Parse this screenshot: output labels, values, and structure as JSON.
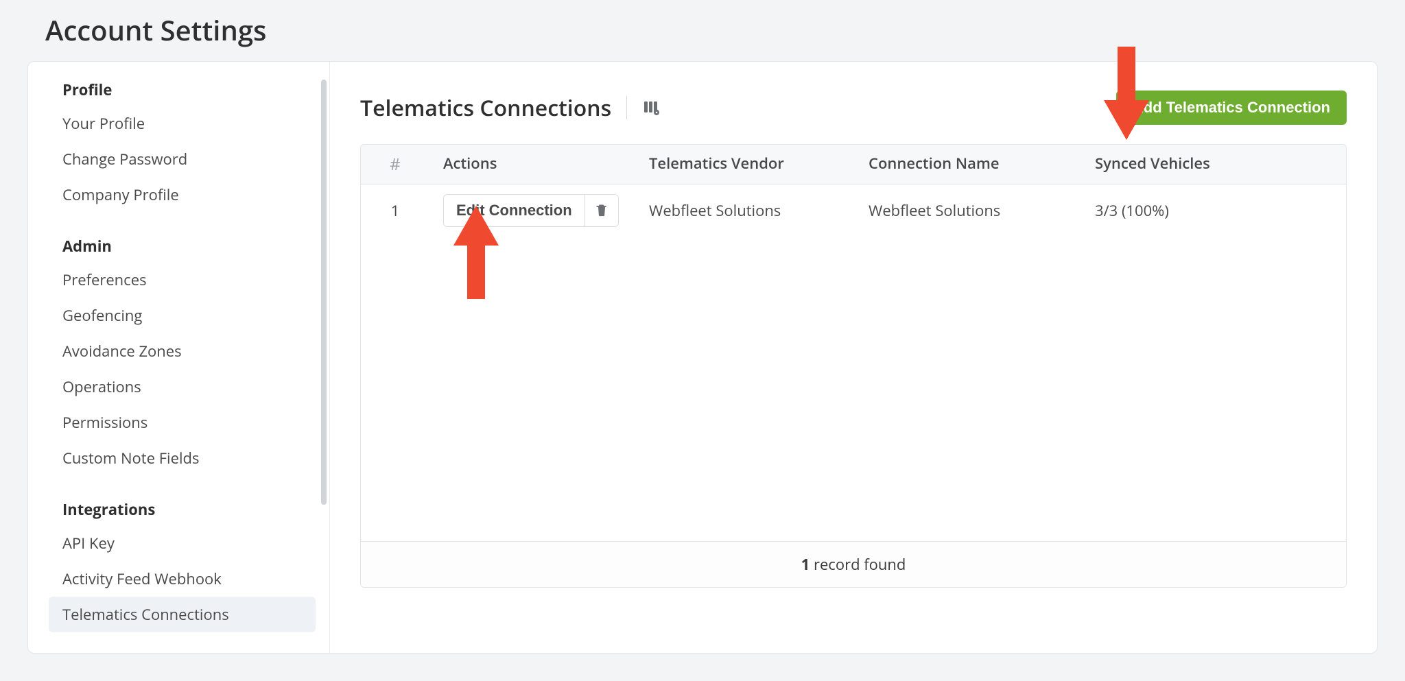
{
  "page": {
    "title": "Account Settings"
  },
  "sidebar": {
    "sections": [
      {
        "heading": "Profile",
        "items": [
          "Your Profile",
          "Change Password",
          "Company Profile"
        ]
      },
      {
        "heading": "Admin",
        "items": [
          "Preferences",
          "Geofencing",
          "Avoidance Zones",
          "Operations",
          "Permissions",
          "Custom Note Fields"
        ]
      },
      {
        "heading": "Integrations",
        "items": [
          "API Key",
          "Activity Feed Webhook",
          "Telematics Connections"
        ]
      }
    ],
    "active": "Telematics Connections"
  },
  "main": {
    "title": "Telematics Connections",
    "add_label": "Add Telematics Connection",
    "columns": {
      "hash": "#",
      "actions": "Actions",
      "vendor": "Telematics Vendor",
      "name": "Connection Name",
      "synced": "Synced Vehicles"
    },
    "rows": [
      {
        "index": "1",
        "edit_label": "Edit Connection",
        "vendor": "Webfleet Solutions",
        "name": "Webfleet Solutions",
        "synced": "3/3 (100%)"
      }
    ],
    "footer": {
      "count": "1",
      "suffix": " record found"
    }
  },
  "colors": {
    "accent_green": "#6fad30",
    "arrow_red": "#ef4a2f"
  }
}
